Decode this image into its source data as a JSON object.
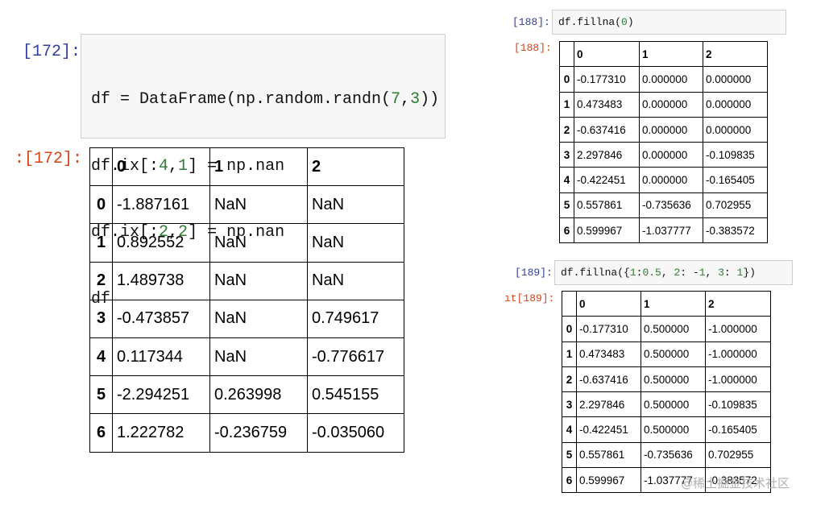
{
  "cell172": {
    "in_prompt": "[172]:",
    "out_prompt": ":[172]:",
    "code_lines": [
      "df = DataFrame(np.random.randn(7,3))",
      "df.ix[:4,1] = np.nan",
      "df.ix[:2,2] = np.nan",
      "df"
    ],
    "table": {
      "columns": [
        "0",
        "1",
        "2"
      ],
      "rows": [
        {
          "idx": "0",
          "values": [
            "-1.887161",
            "NaN",
            "NaN"
          ]
        },
        {
          "idx": "1",
          "values": [
            "0.892552",
            "NaN",
            "NaN"
          ]
        },
        {
          "idx": "2",
          "values": [
            "1.489738",
            "NaN",
            "NaN"
          ]
        },
        {
          "idx": "3",
          "values": [
            "-0.473857",
            "NaN",
            "0.749617"
          ]
        },
        {
          "idx": "4",
          "values": [
            "0.117344",
            "NaN",
            "-0.776617"
          ]
        },
        {
          "idx": "5",
          "values": [
            "-2.294251",
            "0.263998",
            "0.545155"
          ]
        },
        {
          "idx": "6",
          "values": [
            "1.222782",
            "-0.236759",
            "-0.035060"
          ]
        }
      ]
    }
  },
  "cell188": {
    "in_prompt": "[188]:",
    "out_prompt": "[188]:",
    "code": "df.fillna(0)",
    "table": {
      "columns": [
        "0",
        "1",
        "2"
      ],
      "rows": [
        {
          "idx": "0",
          "values": [
            "-0.177310",
            "0.000000",
            "0.000000"
          ]
        },
        {
          "idx": "1",
          "values": [
            "0.473483",
            "0.000000",
            "0.000000"
          ]
        },
        {
          "idx": "2",
          "values": [
            "-0.637416",
            "0.000000",
            "0.000000"
          ]
        },
        {
          "idx": "3",
          "values": [
            "2.297846",
            "0.000000",
            "-0.109835"
          ]
        },
        {
          "idx": "4",
          "values": [
            "-0.422451",
            "0.000000",
            "-0.165405"
          ]
        },
        {
          "idx": "5",
          "values": [
            "0.557861",
            "-0.735636",
            "0.702955"
          ]
        },
        {
          "idx": "6",
          "values": [
            "0.599967",
            "-1.037777",
            "-0.383572"
          ]
        }
      ]
    }
  },
  "cell189": {
    "in_prompt": "[189]:",
    "out_prompt": "ıt[189]:",
    "code": "df.fillna({1:0.5, 2: -1, 3: 1})",
    "table": {
      "columns": [
        "0",
        "1",
        "2"
      ],
      "rows": [
        {
          "idx": "0",
          "values": [
            "-0.177310",
            "0.500000",
            "-1.000000"
          ]
        },
        {
          "idx": "1",
          "values": [
            "0.473483",
            "0.500000",
            "-1.000000"
          ]
        },
        {
          "idx": "2",
          "values": [
            "-0.637416",
            "0.500000",
            "-1.000000"
          ]
        },
        {
          "idx": "3",
          "values": [
            "2.297846",
            "0.500000",
            "-0.109835"
          ]
        },
        {
          "idx": "4",
          "values": [
            "-0.422451",
            "0.500000",
            "-0.165405"
          ]
        },
        {
          "idx": "5",
          "values": [
            "0.557861",
            "-0.735636",
            "0.702955"
          ]
        },
        {
          "idx": "6",
          "values": [
            "0.599967",
            "-1.037777",
            "-0.383572"
          ]
        }
      ]
    }
  },
  "watermark": "@稀土掘金技术社区",
  "colors": {
    "in_prompt": "#303f9f",
    "out_prompt": "#d84315",
    "number_literal": "#2e7d32"
  }
}
